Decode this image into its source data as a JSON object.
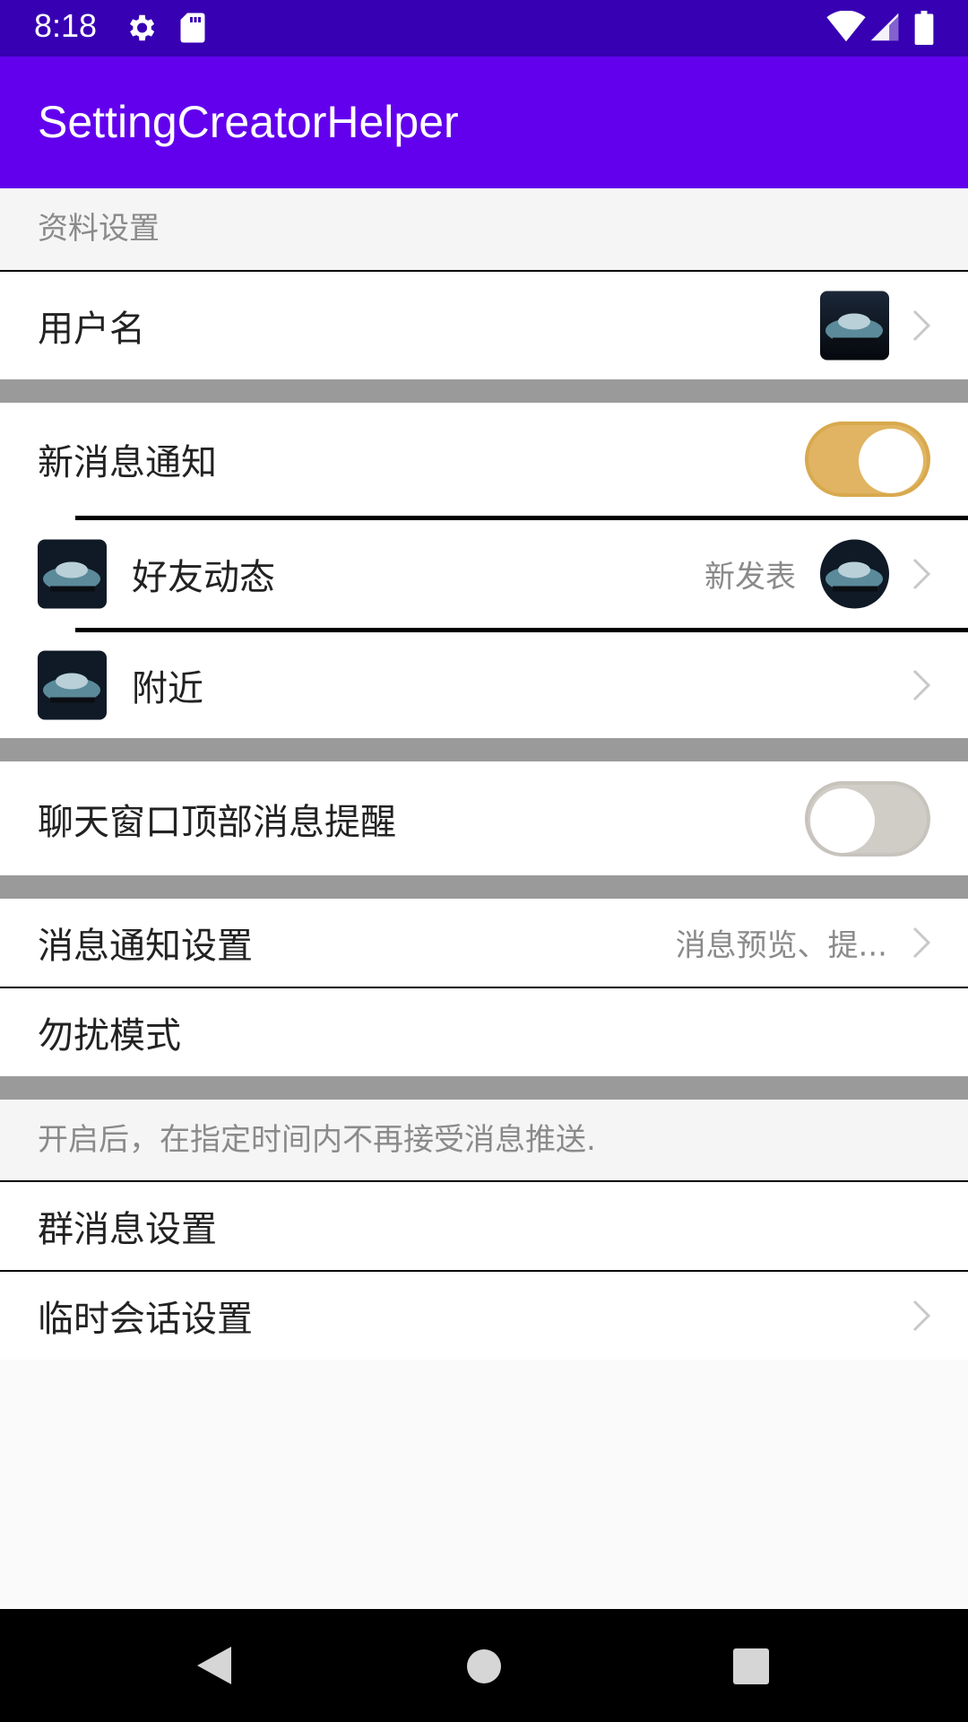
{
  "status_bar": {
    "time": "8:18",
    "icons": [
      "gear-icon",
      "sd-card-icon",
      "wifi-icon",
      "signal-icon",
      "battery-icon"
    ]
  },
  "app_bar": {
    "title": "SettingCreatorHelper"
  },
  "sections": {
    "profile_header": "资料设置",
    "username": {
      "title": "用户名"
    },
    "new_message": {
      "title": "新消息通知",
      "toggle_on": true
    },
    "friend_feed": {
      "title": "好友动态",
      "subtitle": "新发表"
    },
    "nearby": {
      "title": "附近"
    },
    "chat_top_reminder": {
      "title": "聊天窗口顶部消息提醒",
      "toggle_on": false
    },
    "notification_settings": {
      "title": "消息通知设置",
      "subtitle": "消息预览、提..."
    },
    "dnd": {
      "title": "勿扰模式"
    },
    "dnd_note": "开启后，在指定时间内不再接受消息推送.",
    "group_settings": {
      "title": "群消息设置"
    },
    "temp_chat_settings": {
      "title": "临时会话设置"
    }
  },
  "colors": {
    "status_bar": "#3700b3",
    "app_bar": "#6200ee",
    "toggle_on": "#e0b462",
    "toggle_off": "#d0ccc6",
    "gap": "#9a9a9a"
  }
}
